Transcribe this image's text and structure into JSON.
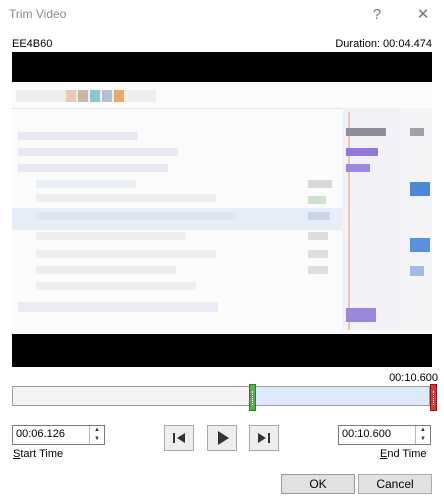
{
  "window": {
    "title": "Trim Video",
    "help_glyph": "?",
    "close_glyph": "✕"
  },
  "video": {
    "filename": "EE4B60",
    "duration": "Duration: 00:04.474"
  },
  "timeline": {
    "end_readout": "00:10.600",
    "selection_start_fraction": 0.577,
    "selection_end_fraction": 1.0
  },
  "start_time": {
    "value": "00:06.126",
    "label_prefix": "S",
    "label_rest": "tart Time"
  },
  "end_time": {
    "value": "00:10.600",
    "label_prefix": "E",
    "label_rest": "nd Time"
  },
  "playback": {
    "prev_icon": "previous-frame-icon",
    "play_icon": "play-icon",
    "next_icon": "next-frame-icon"
  },
  "buttons": {
    "ok": "OK",
    "cancel": "Cancel"
  },
  "colors": {
    "start_handle": "#53b04a",
    "end_handle": "#cf3a3a",
    "selection": "#dbe9f8"
  }
}
